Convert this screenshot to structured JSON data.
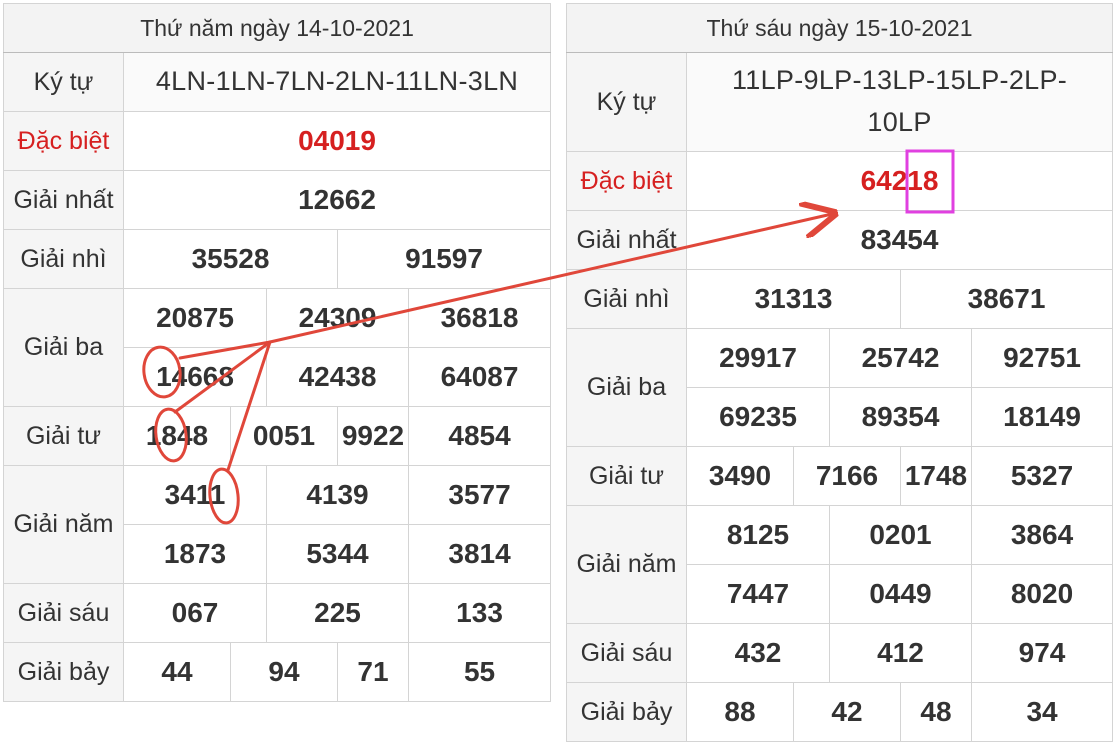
{
  "left": {
    "header": "Thứ năm ngày 14-10-2021",
    "labels": {
      "ky_tu": "Ký tự",
      "dac_biet": "Đặc biệt",
      "giai_nhat": "Giải nhất",
      "giai_nhi": "Giải nhì",
      "giai_ba": "Giải ba",
      "giai_tu": "Giải tư",
      "giai_nam": "Giải năm",
      "giai_sau": "Giải sáu",
      "giai_bay": "Giải bảy"
    },
    "ky_tu": "4LN-1LN-7LN-2LN-11LN-3LN",
    "dac_biet": "04019",
    "giai_nhat": "12662",
    "giai_nhi": [
      "35528",
      "91597"
    ],
    "giai_ba": [
      "20875",
      "24309",
      "36818",
      "14668",
      "42438",
      "64087"
    ],
    "giai_tu": [
      "1848",
      "0051",
      "9922",
      "4854"
    ],
    "giai_nam": [
      "3411",
      "4139",
      "3577",
      "1873",
      "5344",
      "3814"
    ],
    "giai_sau": [
      "067",
      "225",
      "133"
    ],
    "giai_bay": [
      "44",
      "94",
      "71",
      "55"
    ]
  },
  "right": {
    "header": "Thứ sáu ngày 15-10-2021",
    "labels": {
      "ky_tu": "Ký tự",
      "dac_biet": "Đặc biệt",
      "giai_nhat": "Giải nhất",
      "giai_nhi": "Giải nhì",
      "giai_ba": "Giải ba",
      "giai_tu": "Giải tư",
      "giai_nam": "Giải năm",
      "giai_sau": "Giải sáu",
      "giai_bay": "Giải bảy"
    },
    "ky_tu": "11LP-9LP-13LP-15LP-2LP-10LP",
    "dac_biet": "64218",
    "giai_nhat": "83454",
    "giai_nhi": [
      "31313",
      "38671"
    ],
    "giai_ba": [
      "29917",
      "25742",
      "92751",
      "69235",
      "89354",
      "18149"
    ],
    "giai_tu": [
      "3490",
      "7166",
      "1748",
      "5327"
    ],
    "giai_nam": [
      "8125",
      "0201",
      "3864",
      "7447",
      "0449",
      "8020"
    ],
    "giai_sau": [
      "432",
      "412",
      "974"
    ],
    "giai_bay": [
      "88",
      "42",
      "48",
      "34"
    ]
  },
  "colors": {
    "prize_red": "#d62020",
    "annotation_red": "#e0473a",
    "highlight_magenta": "#e040e0"
  }
}
